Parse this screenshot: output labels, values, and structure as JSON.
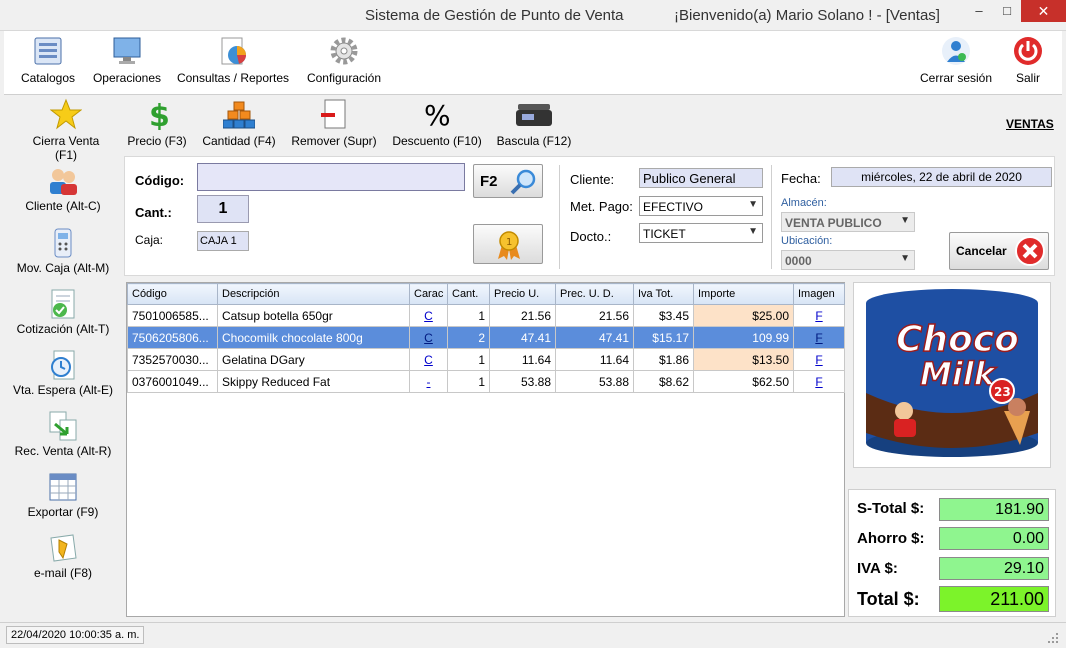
{
  "window": {
    "title": "Sistema de Gestión de Punto de Venta",
    "welcome": "¡Bienvenido(a) Mario Solano ! - [Ventas]",
    "minimize": "–",
    "maximize": "□",
    "close": "✕"
  },
  "menu": {
    "catalogos": "Catalogos",
    "operaciones": "Operaciones",
    "consultas": "Consultas / Reportes",
    "configuracion": "Configuración",
    "cerrar_sesion": "Cerrar sesión",
    "salir": "Salir"
  },
  "toolbar": {
    "cierra_venta": "Cierra Venta (F1)",
    "precio": "Precio (F3)",
    "cantidad": "Cantidad (F4)",
    "remover": "Remover (Supr)",
    "descuento": "Descuento (F10)",
    "bascula": "Bascula (F12)",
    "ventas": "VENTAS"
  },
  "side": {
    "cliente": "Cliente (Alt-C)",
    "mov_caja": "Mov. Caja (Alt-M)",
    "cotizacion": "Cotización (Alt-T)",
    "vta_espera": "Vta. Espera (Alt-E)",
    "rec_venta": "Rec. Venta (Alt-R)",
    "exportar": "Exportar (F9)",
    "email": "e-mail (F8)"
  },
  "form": {
    "codigo_label": "Código:",
    "codigo_value": "",
    "cant_label": "Cant.:",
    "cant_value": "1",
    "caja_label": "Caja:",
    "caja_value": "CAJA 1",
    "f2_label": "F2",
    "cliente_label": "Cliente:",
    "cliente_value": "Publico General",
    "metpago_label": "Met. Pago:",
    "metpago_value": "EFECTIVO",
    "docto_label": "Docto.:",
    "docto_value": "TICKET",
    "fecha_label": "Fecha:",
    "fecha_value": "miércoles, 22 de abril de 2020",
    "almacen_label": "Almacén:",
    "almacen_value": "VENTA PUBLICO",
    "ubicacion_label": "Ubicación:",
    "ubicacion_value": "0000",
    "cancelar_label": "Cancelar"
  },
  "grid": {
    "columns": [
      "Código",
      "Descripción",
      "Carac",
      "Cant.",
      "Precio U.",
      "Prec. U. D.",
      "Iva Tot.",
      "Importe",
      "Imagen"
    ],
    "rows": [
      {
        "codigo": "7501006585...",
        "desc": "Catsup botella 650gr",
        "carac": "C",
        "cant": "1",
        "precio": "21.56",
        "precud": "21.56",
        "iva": "$3.45",
        "importe": "$25.00",
        "imagen": "F",
        "selected": false,
        "hl": true
      },
      {
        "codigo": "7506205806...",
        "desc": "Chocomilk chocolate 800g",
        "carac": "C",
        "cant": "2",
        "precio": "47.41",
        "precud": "47.41",
        "iva": "$15.17",
        "importe": "109.99",
        "imagen": "F",
        "selected": true,
        "hl": false
      },
      {
        "codigo": "7352570030...",
        "desc": "Gelatina DGary",
        "carac": "C",
        "cant": "1",
        "precio": "11.64",
        "precud": "11.64",
        "iva": "$1.86",
        "importe": "$13.50",
        "imagen": "F",
        "selected": false,
        "hl": true
      },
      {
        "codigo": "0376001049...",
        "desc": "Skippy Reduced Fat",
        "carac": "-",
        "cant": "1",
        "precio": "53.88",
        "precud": "53.88",
        "iva": "$8.62",
        "importe": "$62.50",
        "imagen": "F",
        "selected": false,
        "hl": false
      }
    ]
  },
  "product_image": {
    "brand_line1": "Choco",
    "brand_line2": "Milk",
    "badge": "23"
  },
  "totals": {
    "subtotal_label": "S-Total $:",
    "subtotal": "181.90",
    "ahorro_label": "Ahorro $:",
    "ahorro": "0.00",
    "iva_label": "IVA $:",
    "iva": "29.10",
    "total_label": "Total $:",
    "total": "211.00"
  },
  "status": {
    "datetime": "22/04/2020 10:00:35 a. m."
  },
  "colors": {
    "selected_row": "#5b8ddb",
    "importe_highlight": "#fde2c8",
    "total_green": "#8ff58f",
    "grand_total_green": "#7cf32a",
    "close_button": "#c7302a"
  }
}
